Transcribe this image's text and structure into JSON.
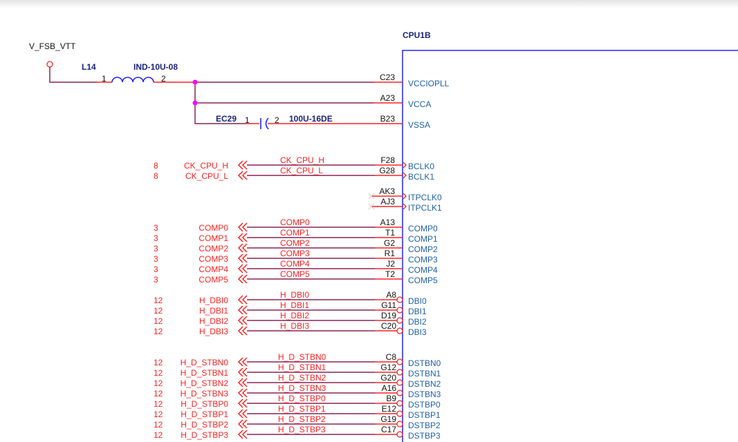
{
  "power_net": "V_FSB_VTT",
  "component": {
    "ref": "CPU1B"
  },
  "inductor": {
    "ref": "L14",
    "value": "IND-10U-08",
    "pin1": "1",
    "pin2": "2"
  },
  "capacitor": {
    "ref": "EC29",
    "value": "100U-16DE",
    "pin1": "1",
    "pin2": "2"
  },
  "power_pins": [
    {
      "pin": "C23",
      "name": "VCCIOPLL"
    },
    {
      "pin": "A23",
      "name": "VCCA"
    },
    {
      "pin": "B23",
      "name": "VSSA"
    }
  ],
  "signals": [
    {
      "page": "8",
      "net": "CK_CPU_H",
      "pin": "F28",
      "name": "BCLK0",
      "type": "in"
    },
    {
      "page": "8",
      "net": "CK_CPU_L",
      "pin": "G28",
      "name": "BCLK1",
      "type": "in"
    },
    {
      "page": "",
      "net": "",
      "pin": "AK3",
      "name": "ITPCLK0",
      "type": "nc"
    },
    {
      "page": "",
      "net": "",
      "pin": "AJ3",
      "name": "ITPCLK1",
      "type": "nc"
    },
    {
      "page": "3",
      "net": "COMP0",
      "pin": "A13",
      "name": "COMP0",
      "type": "plain"
    },
    {
      "page": "3",
      "net": "COMP1",
      "pin": "T1",
      "name": "COMP1",
      "type": "plain"
    },
    {
      "page": "3",
      "net": "COMP2",
      "pin": "G2",
      "name": "COMP2",
      "type": "plain"
    },
    {
      "page": "3",
      "net": "COMP3",
      "pin": "R1",
      "name": "COMP3",
      "type": "plain"
    },
    {
      "page": "3",
      "net": "COMP4",
      "pin": "J2",
      "name": "COMP4",
      "type": "plain"
    },
    {
      "page": "3",
      "net": "COMP5",
      "pin": "T2",
      "name": "COMP5",
      "type": "plain"
    },
    {
      "page": "12",
      "net": "H_DBI0",
      "pin": "A8",
      "name": "DBI0",
      "type": "bidir"
    },
    {
      "page": "12",
      "net": "H_DBI1",
      "pin": "G11",
      "name": "DBI1",
      "type": "bidir"
    },
    {
      "page": "12",
      "net": "H_DBI2",
      "pin": "D19",
      "name": "DBI2",
      "type": "bidir"
    },
    {
      "page": "12",
      "net": "H_DBI3",
      "pin": "C20",
      "name": "DBI3",
      "type": "bidir"
    },
    {
      "page": "12",
      "net": "H_D_STBN0",
      "pin": "C8",
      "name": "DSTBN0",
      "type": "bidir"
    },
    {
      "page": "12",
      "net": "H_D_STBN1",
      "pin": "G12",
      "name": "DSTBN1",
      "type": "bidir"
    },
    {
      "page": "12",
      "net": "H_D_STBN2",
      "pin": "G20",
      "name": "DSTBN2",
      "type": "bidir"
    },
    {
      "page": "12",
      "net": "H_D_STBN3",
      "pin": "A16",
      "name": "DSTBN3",
      "type": "bidir"
    },
    {
      "page": "12",
      "net": "H_D_STBP0",
      "pin": "B9",
      "name": "DSTBP0",
      "type": "bidir"
    },
    {
      "page": "12",
      "net": "H_D_STBP1",
      "pin": "E12",
      "name": "DSTBP1",
      "type": "bidir"
    },
    {
      "page": "12",
      "net": "H_D_STBP2",
      "pin": "G19",
      "name": "DSTBP2",
      "type": "bidir"
    },
    {
      "page": "12",
      "net": "H_D_STBP3",
      "pin": "C17",
      "name": "DSTBP3",
      "type": "bidir"
    }
  ],
  "colors": {
    "wire": "#8b2252",
    "pin": "#ff2020",
    "body": "#2020ff",
    "junction": "#ff00ff"
  }
}
